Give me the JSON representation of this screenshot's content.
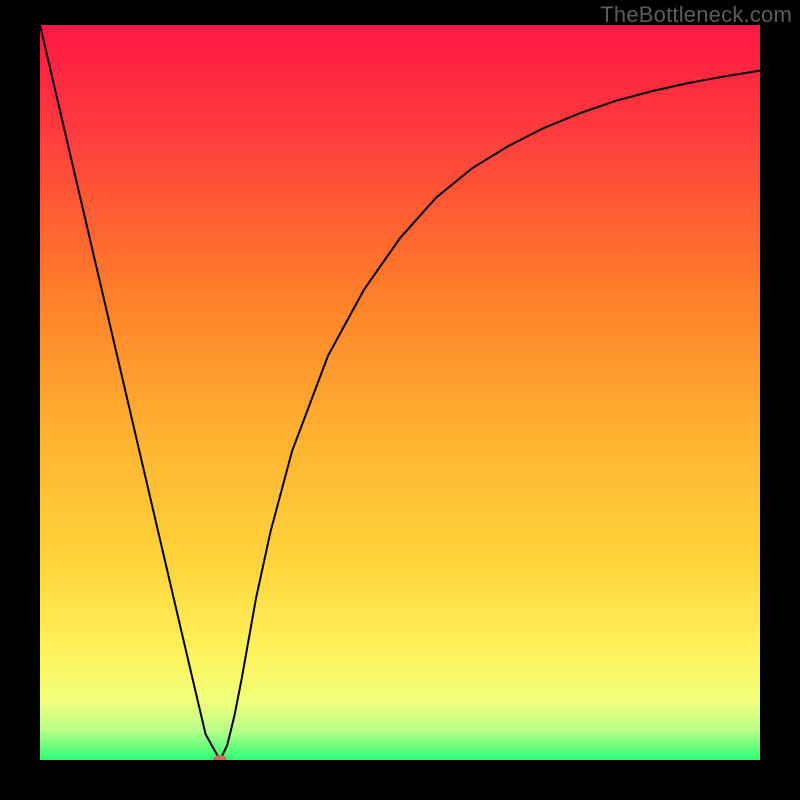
{
  "watermark": "TheBottleneck.com",
  "chart_data": {
    "type": "line",
    "title": "",
    "xlabel": "",
    "ylabel": "",
    "xlim": [
      0,
      100
    ],
    "ylim": [
      0,
      100
    ],
    "grid": false,
    "legend": false,
    "background_gradient": {
      "stops": [
        {
          "offset": 0.0,
          "color": "#ff1744"
        },
        {
          "offset": 0.15,
          "color": "#ff3d3d"
        },
        {
          "offset": 0.35,
          "color": "#ff7a2a"
        },
        {
          "offset": 0.55,
          "color": "#ffb030"
        },
        {
          "offset": 0.72,
          "color": "#ffd23a"
        },
        {
          "offset": 0.85,
          "color": "#fff15a"
        },
        {
          "offset": 0.92,
          "color": "#f1ff7a"
        },
        {
          "offset": 0.96,
          "color": "#b8ff8a"
        },
        {
          "offset": 1.0,
          "color": "#2aff74"
        }
      ]
    },
    "series": [
      {
        "name": "curve",
        "color": "#000000",
        "width": 2,
        "x": [
          0,
          5,
          10,
          15,
          20,
          23,
          25,
          26,
          27,
          28,
          30,
          32,
          35,
          40,
          45,
          50,
          55,
          60,
          65,
          70,
          75,
          80,
          85,
          90,
          95,
          100
        ],
        "y": [
          100,
          79,
          58,
          37,
          16,
          3.5,
          0,
          2,
          6,
          11,
          22,
          31,
          42,
          55,
          64,
          71,
          76.5,
          80.5,
          83.5,
          86,
          88,
          89.7,
          91,
          92.1,
          93,
          93.8
        ]
      }
    ],
    "markers": [
      {
        "name": "min-point",
        "x": 25,
        "y": 0,
        "rx": 7,
        "ry": 5,
        "fill": "#d46a5a"
      }
    ]
  }
}
